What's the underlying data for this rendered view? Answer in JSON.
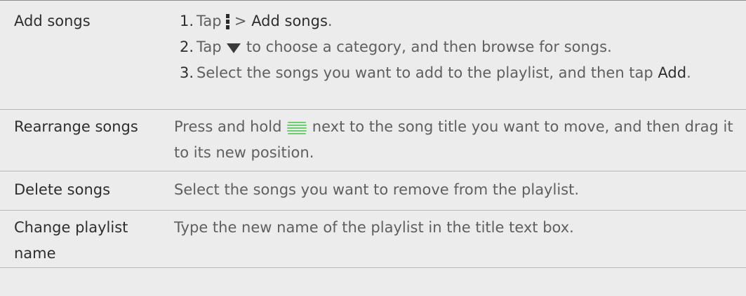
{
  "rows": [
    {
      "label": "Add songs",
      "steps": [
        {
          "num": "1.",
          "pre": "Tap ",
          "icon": "menu-vertical-icon",
          "mid": " > ",
          "bold": "Add songs",
          "post": "."
        },
        {
          "num": "2.",
          "pre": "Tap ",
          "icon": "triangle-down-icon",
          "post": " to choose a category, and then browse for songs."
        },
        {
          "num": "3.",
          "pre": "Select the songs you want to add to the playlist, and then tap ",
          "bold": "Add",
          "post": "."
        }
      ]
    },
    {
      "label": "Rearrange songs",
      "pre": "Press and hold ",
      "icon": "drag-handle-icon",
      "post": " next to the song title you want to move, and then drag it to its new position."
    },
    {
      "label": "Delete songs",
      "text": "Select the songs you want to remove from the playlist."
    },
    {
      "label": "Change playlist name",
      "text": "Type the new name of the playlist in the title text box."
    }
  ]
}
